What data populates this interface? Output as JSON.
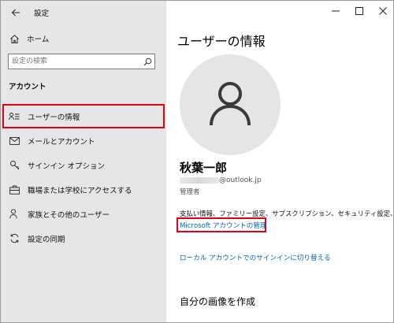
{
  "window": {
    "title": "設定"
  },
  "sidebar": {
    "home_label": "ホーム",
    "search_placeholder": "設定の検索",
    "section_heading": "アカウント",
    "items": [
      {
        "label": "ユーザーの情報",
        "icon": "user-info-icon",
        "selected": true
      },
      {
        "label": "メールとアカウント",
        "icon": "mail-icon",
        "selected": false
      },
      {
        "label": "サインイン オプション",
        "icon": "key-icon",
        "selected": false
      },
      {
        "label": "職場または学校にアクセスする",
        "icon": "briefcase-icon",
        "selected": false
      },
      {
        "label": "家族とその他のユーザー",
        "icon": "person-plus-icon",
        "selected": false
      },
      {
        "label": "設定の同期",
        "icon": "sync-icon",
        "selected": false
      }
    ]
  },
  "content": {
    "page_title": "ユーザーの情報",
    "user_name": "秋葉一郎",
    "email_domain": "@outlook.jp",
    "role": "管理者",
    "billing_text": "支払い情報、ファミリー設定、サブスクリプション、セキュリティ設定、その他",
    "manage_link": "Microsoft アカウントの管理",
    "local_link": "ローカル アカウントでのサインインに切り替える",
    "picture_section_title": "自分の画像を作成"
  },
  "colors": {
    "accent": "#0063b1",
    "highlight": "#e0001b",
    "sidebar_bg": "#e6e6e6",
    "avatar_bg": "#e5e5e5"
  }
}
